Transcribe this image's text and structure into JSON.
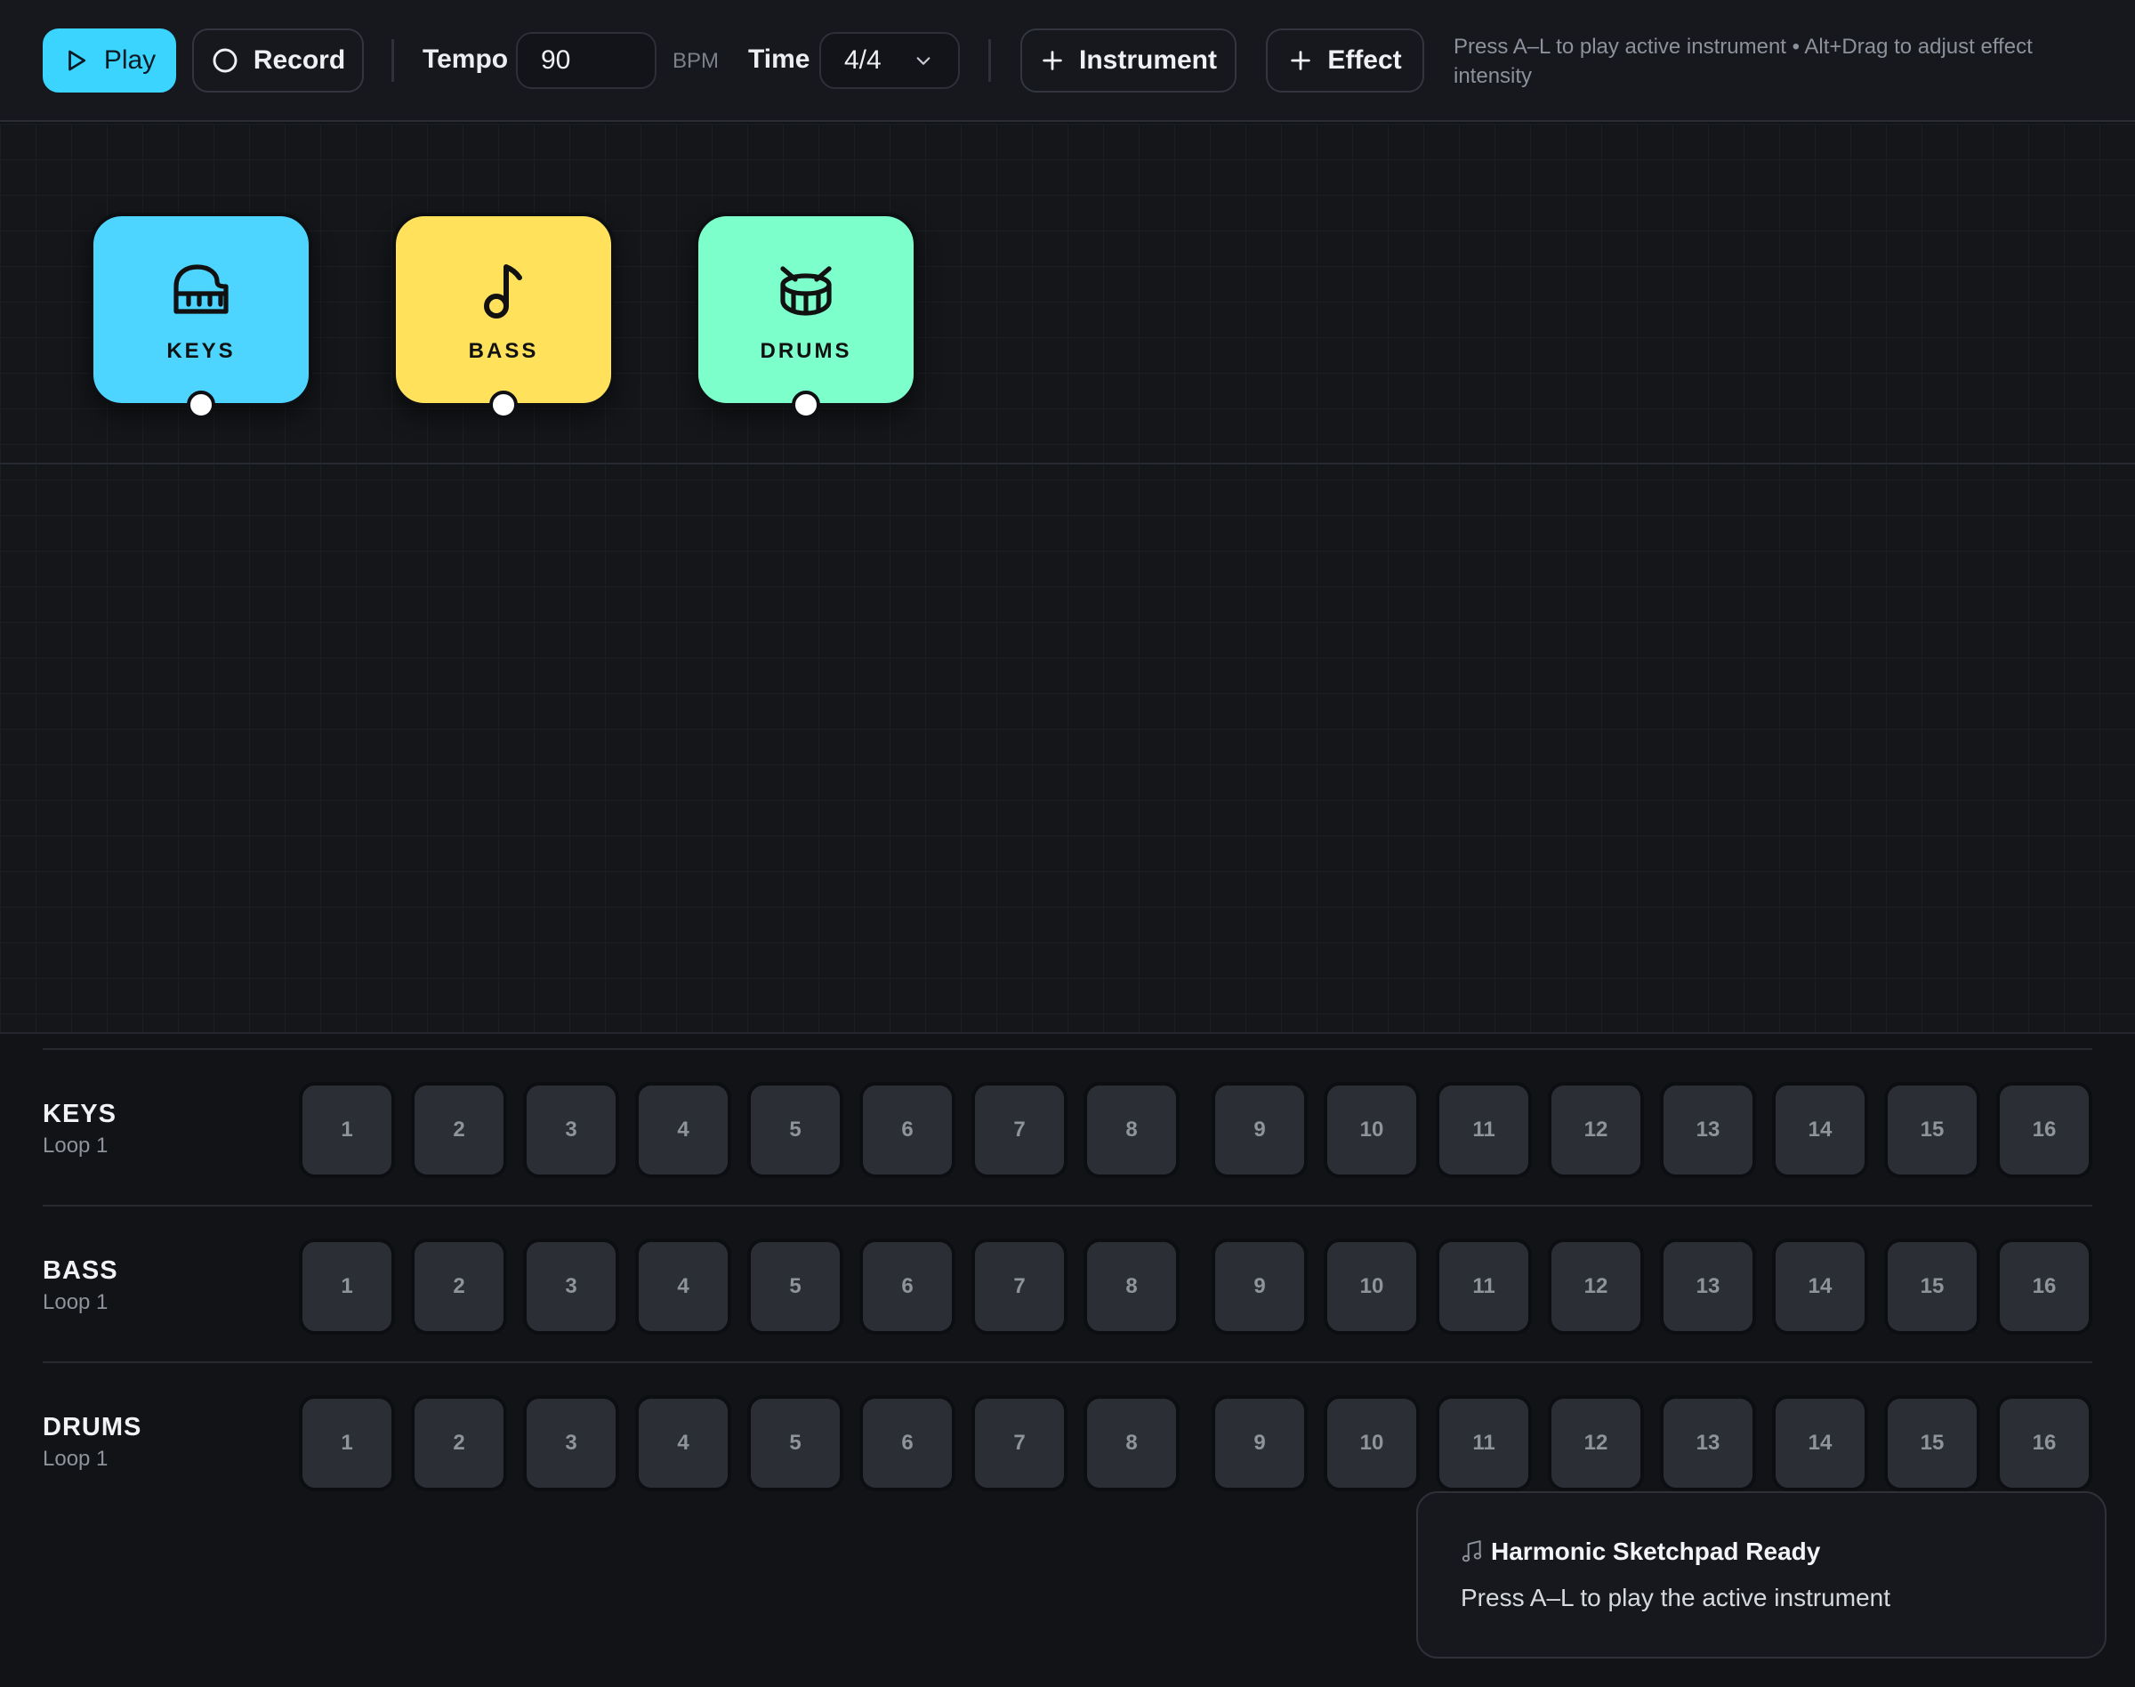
{
  "toolbar": {
    "play_label": "Play",
    "record_label": "Record",
    "tempo_label": "Tempo",
    "tempo_value": "90",
    "tempo_unit": "BPM",
    "time_label": "Time",
    "time_value": "4/4",
    "add_instrument_label": "Instrument",
    "add_effect_label": "Effect",
    "hint": "Press A–L to play active instrument • Alt+Drag to adjust effect intensity",
    "accent_color": "#3ad4ff"
  },
  "instruments": [
    {
      "name": "KEYS",
      "icon": "piano-icon",
      "color": "#4dd4ff"
    },
    {
      "name": "BASS",
      "icon": "music-note-icon",
      "color": "#ffe15c"
    },
    {
      "name": "DRUMS",
      "icon": "drum-icon",
      "color": "#7dffcb"
    }
  ],
  "sequencer": {
    "tracks": [
      {
        "name": "KEYS",
        "loop": "Loop 1"
      },
      {
        "name": "BASS",
        "loop": "Loop 1"
      },
      {
        "name": "DRUMS",
        "loop": "Loop 1"
      }
    ],
    "steps": [
      "1",
      "2",
      "3",
      "4",
      "5",
      "6",
      "7",
      "8",
      "9",
      "10",
      "11",
      "12",
      "13",
      "14",
      "15",
      "16"
    ]
  },
  "toast": {
    "icon": "music-note-icon",
    "title": "Harmonic Sketchpad Ready",
    "message": "Press A–L to play the active instrument"
  }
}
